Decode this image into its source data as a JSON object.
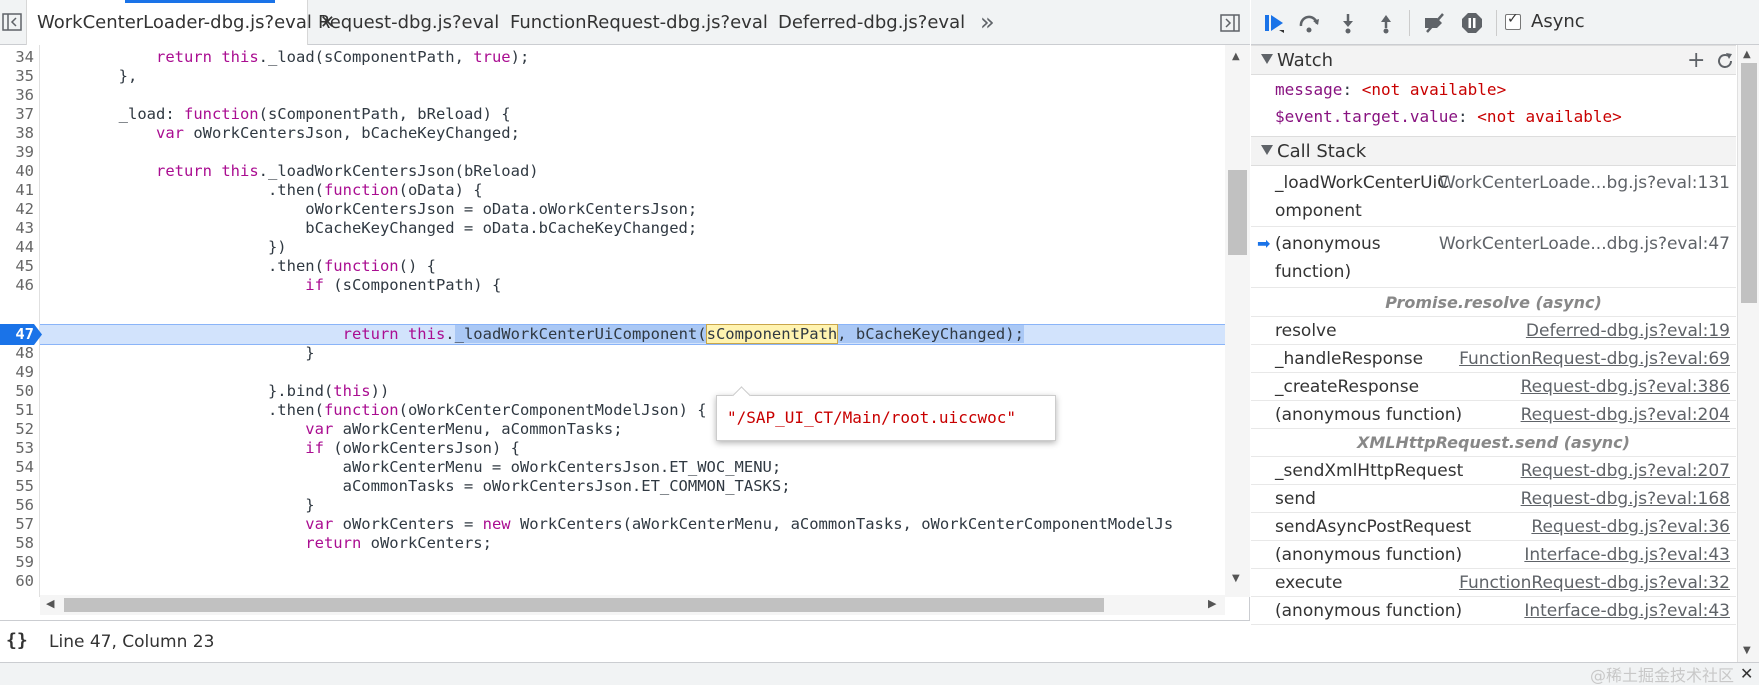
{
  "tabs": [
    {
      "label": "WorkCenterLoader-dbg.js?eval",
      "active": true,
      "closable": true
    },
    {
      "label": "Request-dbg.js?eval"
    },
    {
      "label": "FunctionRequest-dbg.js?eval"
    },
    {
      "label": "Deferred-dbg.js?eval"
    }
  ],
  "tabs_overflow": "»",
  "code": {
    "line_numbers": [
      "34",
      "35",
      "36",
      "37",
      "38",
      "39",
      "40",
      "41",
      "42",
      "43",
      "44",
      "45",
      "46",
      "47",
      "48",
      "49",
      "50",
      "51",
      "52",
      "53",
      "54",
      "55",
      "56",
      "57",
      "58",
      "59",
      "60"
    ],
    "current_line": "47"
  },
  "popover": {
    "value": "\"/SAP_UI_CT/Main/root.uiccwoc\""
  },
  "status": {
    "pretty_print": "{}",
    "cursor_position": "Line 47, Column 23"
  },
  "toolbar": {
    "async_label": "Async",
    "async_checked": true
  },
  "watch": {
    "title": "Watch",
    "items": [
      {
        "name": "message",
        "value": "<not available>"
      },
      {
        "name": "$event.target.value",
        "value": "<not available>"
      }
    ]
  },
  "call_stack": {
    "title": "Call Stack",
    "frames": [
      {
        "fn": "_loadWorkCenterUiC",
        "fn2": "omponent",
        "loc": "WorkCenterLoade...bg.js?eval:131",
        "underline": false
      },
      {
        "fn": "(anonymous",
        "fn2": "function)",
        "loc": "WorkCenterLoade...dbg.js?eval:47",
        "current": true,
        "underline": false
      },
      {
        "async": "Promise.resolve (async)"
      },
      {
        "fn": "resolve",
        "loc": "Deferred-dbg.js?eval:19"
      },
      {
        "fn": "_handleResponse",
        "loc": "FunctionRequest-dbg.js?eval:69"
      },
      {
        "fn": "_createResponse",
        "loc": "Request-dbg.js?eval:386"
      },
      {
        "fn": "(anonymous function)",
        "loc": "Request-dbg.js?eval:204"
      },
      {
        "async": "XMLHttpRequest.send (async)"
      },
      {
        "fn": "_sendXmlHttpRequest",
        "loc": "Request-dbg.js?eval:207"
      },
      {
        "fn": "send",
        "loc": "Request-dbg.js?eval:168"
      },
      {
        "fn": "sendAsyncPostRequest",
        "loc": "Request-dbg.js?eval:36"
      },
      {
        "fn": "(anonymous function)",
        "loc": "Interface-dbg.js?eval:43"
      },
      {
        "fn": "execute",
        "loc": "FunctionRequest-dbg.js?eval:32"
      },
      {
        "fn": "(anonymous function)",
        "loc": "Interface-dbg.js?eval:43"
      }
    ]
  },
  "watermark": "@稀土掘金技术社区",
  "colors": {
    "accent": "#1a73e8",
    "keyword": "#aa0d91",
    "string": "#c80000",
    "exec_line": "#d2e3fc"
  }
}
